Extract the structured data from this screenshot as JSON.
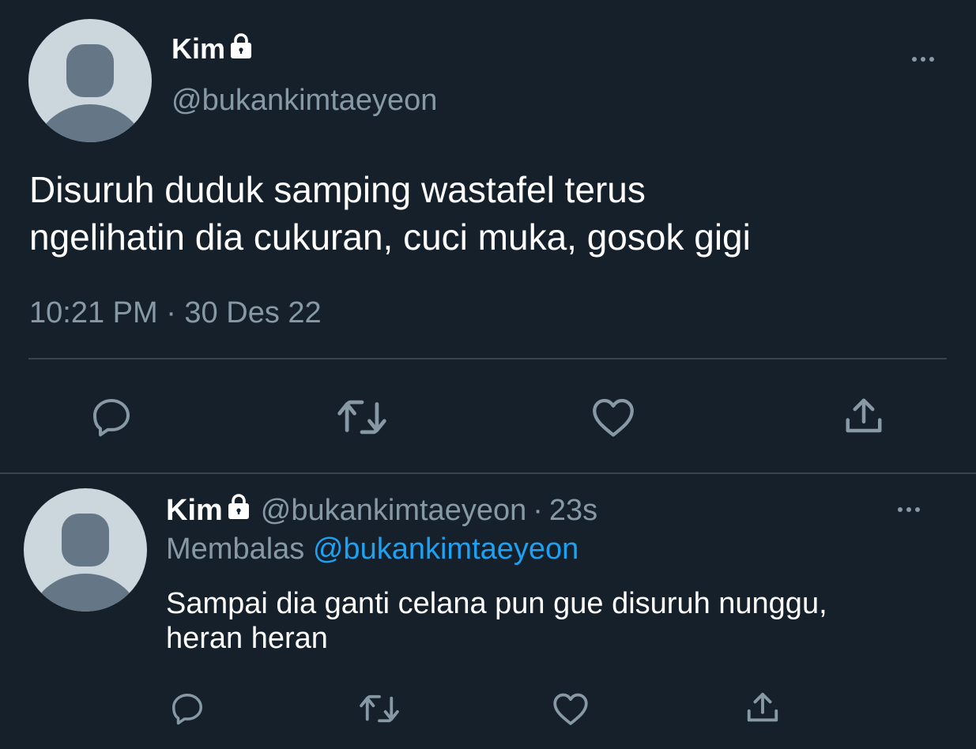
{
  "main_tweet": {
    "display_name": "Kim",
    "handle": "@bukankimtaeyeon",
    "text_line1": "Disuruh duduk samping wastafel terus",
    "text_line2": "ngelihatin dia cukuran, cuci muka, gosok gigi",
    "timestamp": "10:21 PM · 30 Des 22",
    "actions": [
      "reply-icon",
      "retweet-icon",
      "like-icon",
      "share-icon"
    ]
  },
  "reply_tweet": {
    "display_name": "Kim",
    "handle": "@bukankimtaeyeon",
    "separator": "·",
    "time": "23s",
    "replying_label": "Membalas",
    "replying_to": "@bukankimtaeyeon",
    "text_line1": "Sampai dia ganti celana pun gue disuruh nunggu,",
    "text_line2": "heran heran",
    "actions": [
      "reply-icon",
      "retweet-icon",
      "like-icon",
      "share-icon"
    ]
  },
  "colors": {
    "background": "#15202b",
    "text": "#ffffff",
    "muted": "#8899a6",
    "link": "#1da1f2",
    "divider": "#38444d",
    "avatar_bg": "#ccd6dd",
    "avatar_fg": "#657786"
  }
}
